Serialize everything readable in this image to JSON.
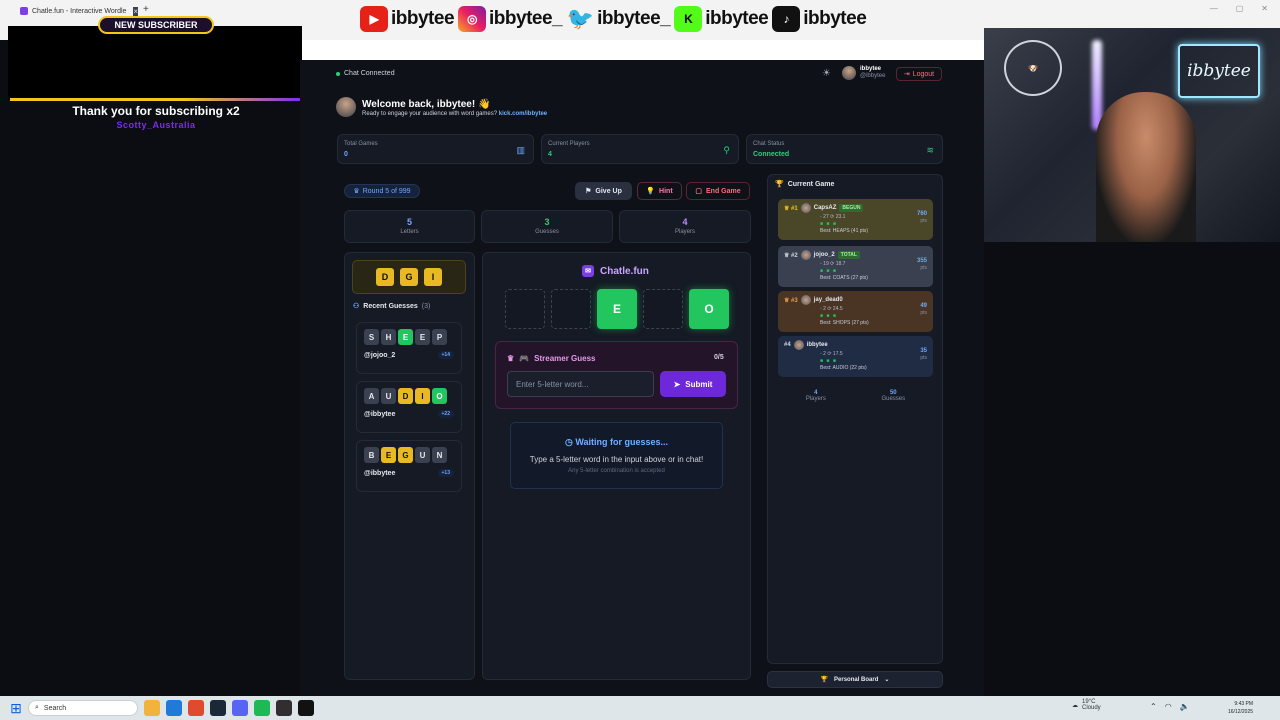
{
  "browser": {
    "tab_title": "Chatle.fun - Interactive Wordle",
    "new_tab": "+",
    "window_controls": [
      "—",
      "▢",
      "✕"
    ]
  },
  "socials": {
    "handles": [
      "ibbytee",
      "ibbytee_",
      "ibbytee_",
      "ibbytee",
      "ibbytee"
    ]
  },
  "subscriber_alert": {
    "badge": "NEW SUBSCRIBER",
    "message": "Thank you for subscribing x2",
    "name": "Scotty_Australia"
  },
  "webcam": {
    "sign_text": "ibbytee"
  },
  "app": {
    "chat_connected": "Chat Connected",
    "user": {
      "name": "ibbytee",
      "handle": "@ibbytee"
    },
    "logout": "Logout",
    "welcome": {
      "title": "Welcome back, ibbytee! 👋",
      "subtitle": "Ready to engage your audience with word games?",
      "link": "kick.com/ibbytee"
    },
    "stats": [
      {
        "label": "Total Games",
        "value": "0",
        "color": "#6fa8ff"
      },
      {
        "label": "Current Players",
        "value": "4",
        "color": "#27d07a"
      },
      {
        "label": "Chat Status",
        "value": "Connected",
        "color": "#27d07a"
      }
    ],
    "round": "Round 5 of 999",
    "actions": {
      "give_up": "Give Up",
      "hint": "Hint",
      "end_game": "End Game"
    },
    "info": [
      {
        "value": "5",
        "label": "Letters",
        "color": "#6fa8ff"
      },
      {
        "value": "3",
        "label": "Guesses",
        "color": "#27d07a"
      },
      {
        "value": "4",
        "label": "Players",
        "color": "#b98cff"
      }
    ],
    "known_letters": [
      "D",
      "G",
      "I"
    ],
    "recent_guesses": {
      "title": "Recent Guesses",
      "count": "(3)",
      "items": [
        {
          "letters": [
            "S",
            "H",
            "E",
            "E",
            "P"
          ],
          "states": [
            "x",
            "x",
            "g",
            "x",
            "x"
          ],
          "user": "@jojoo_2",
          "points": "+14"
        },
        {
          "letters": [
            "A",
            "U",
            "D",
            "I",
            "O"
          ],
          "states": [
            "x",
            "x",
            "y",
            "y",
            "g"
          ],
          "user": "@ibbytee",
          "points": "+22"
        },
        {
          "letters": [
            "B",
            "E",
            "G",
            "U",
            "N"
          ],
          "states": [
            "x",
            "y",
            "y",
            "x",
            "x"
          ],
          "user": "@ibbytee",
          "points": "+13"
        }
      ]
    },
    "brand": "Chatle.fun",
    "board": [
      "",
      "",
      "E",
      "",
      "O"
    ],
    "streamer_guess": {
      "title": "Streamer Guess",
      "count": "0/5",
      "placeholder": "Enter 5-letter word...",
      "submit": "Submit"
    },
    "waiting": {
      "title": "Waiting for guesses...",
      "subtitle": "Type a 5-letter word in the input above or in chat!",
      "note": "Any 5-letter combination is accepted"
    },
    "current_game": {
      "title": "Current Game",
      "players": [
        {
          "rank": "#1",
          "name": "CapsAZ",
          "tag": "BEGUN",
          "meta": "◦ 27 ⟳ 23.1",
          "best": "Best: HEAPS (41 pts)",
          "score": "760",
          "unit": "pts"
        },
        {
          "rank": "#2",
          "name": "jojoo_2",
          "tag": "TOTAL",
          "meta": "◦ 19 ⟳ 18.7",
          "best": "Best: COATS (27 pts)",
          "score": "355",
          "unit": "pts"
        },
        {
          "rank": "#3",
          "name": "jay_dead0",
          "tag": "",
          "meta": "◦ 2 ⟳ 24.5",
          "best": "Best: SHOPS (27 pts)",
          "score": "49",
          "unit": "pts"
        },
        {
          "rank": "#4",
          "name": "ibbytee",
          "tag": "",
          "meta": "◦ 2 ⟳ 17.5",
          "best": "Best: AUDIO (22 pts)",
          "score": "35",
          "unit": "pts"
        }
      ],
      "footer": [
        {
          "value": "4",
          "label": "Players"
        },
        {
          "value": "50",
          "label": "Guesses"
        }
      ]
    },
    "personal_board": "Personal Board"
  },
  "taskbar": {
    "search": "Search",
    "weather": {
      "temp": "19°C",
      "desc": "Cloudy"
    },
    "clock": {
      "time": "9:43 PM",
      "date": "16/12/2025"
    }
  }
}
